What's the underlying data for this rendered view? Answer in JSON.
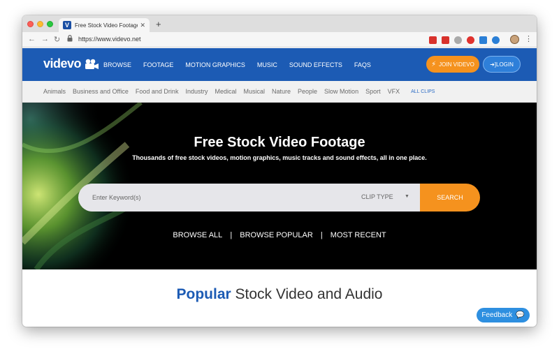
{
  "browser": {
    "tab_title": "Free Stock Video Footage & M",
    "tab_favicon": "V",
    "tab_close": "✕",
    "new_tab": "+",
    "url": "https://www.videvo.net",
    "back": "←",
    "forward": "→",
    "reload": "↻",
    "star": "☆",
    "menu": "⋮",
    "extension_colors": [
      "#d8322c",
      "#d8322c",
      "#aaaaaa",
      "#e0322e",
      "#2b7fd6",
      "#2b7fd6",
      "#d81a2f"
    ]
  },
  "site": {
    "logo_text": "videvo",
    "brand_color": "#1c5bb4",
    "accent_color": "#f5921e",
    "nav": [
      "BROWSE",
      "FOOTAGE",
      "MOTION GRAPHICS",
      "MUSIC",
      "SOUND EFFECTS",
      "FAQS"
    ],
    "join_label": "JOIN VIDEVO",
    "login_label": "➜]LOGIN",
    "categories": [
      "Animals",
      "Business and Office",
      "Food and Drink",
      "Industry",
      "Medical",
      "Musical",
      "Nature",
      "People",
      "Slow Motion",
      "Sport",
      "VFX"
    ],
    "all_clips": "ALL CLIPS"
  },
  "hero": {
    "title": "Free Stock Video Footage",
    "subtitle": "Thousands of free stock videos, motion graphics, music tracks and sound effects, all in one place.",
    "search_placeholder": "Enter Keyword(s)",
    "clip_type": "CLIP TYPE",
    "search_label": "SEARCH",
    "browse_links": [
      "BROWSE ALL",
      "|",
      "BROWSE POPULAR",
      "|",
      "MOST RECENT"
    ]
  },
  "popular": {
    "highlight": "Popular",
    "rest": " Stock Video and Audio"
  },
  "feedback": {
    "label": "Feedback"
  }
}
